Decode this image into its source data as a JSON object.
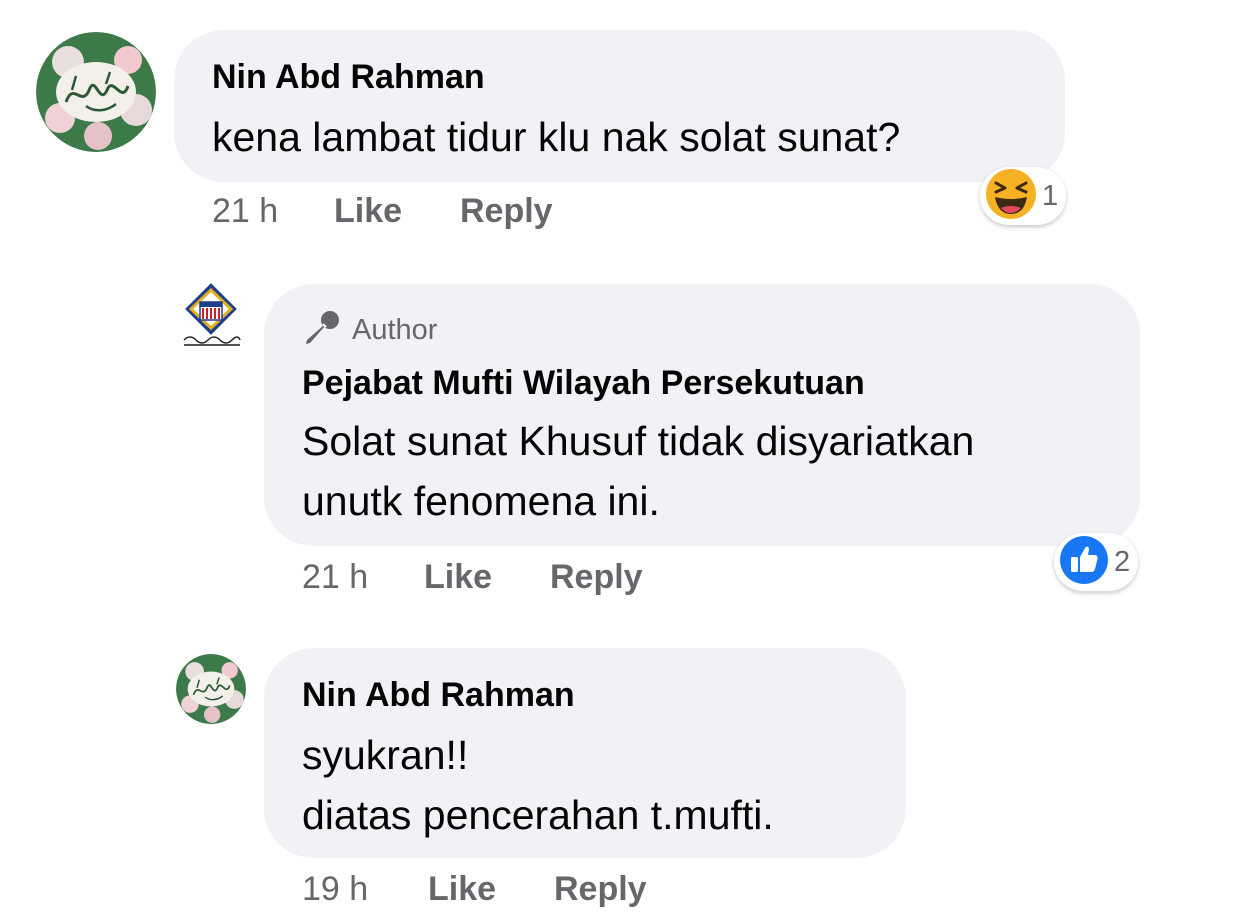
{
  "colors": {
    "bubble_bg": "#f0f2f5",
    "meta_text": "#65676b",
    "like_blue": "#1877f2",
    "haha_yellow": "#f7b125"
  },
  "comments": [
    {
      "author": "Nin Abd Rahman",
      "text_lines": [
        "kena lambat tidur klu nak solat sunat?"
      ],
      "time": "21 h",
      "like_label": "Like",
      "reply_label": "Reply",
      "reaction": {
        "icon": "haha-emoji-icon",
        "count": "1"
      }
    },
    {
      "badge_label": "Author",
      "badge_icon": "microphone-icon",
      "author": "Pejabat Mufti Wilayah Persekutuan",
      "text_lines": [
        "Solat sunat Khusuf tidak disyariatkan",
        "unutk fenomena ini."
      ],
      "time": "21 h",
      "like_label": "Like",
      "reply_label": "Reply",
      "reaction": {
        "icon": "like-thumb-icon",
        "count": "2"
      }
    },
    {
      "author": "Nin Abd Rahman",
      "text_lines": [
        "syukran!!",
        "diatas pencerahan t.mufti."
      ],
      "time": "19 h",
      "like_label": "Like",
      "reply_label": "Reply"
    }
  ]
}
